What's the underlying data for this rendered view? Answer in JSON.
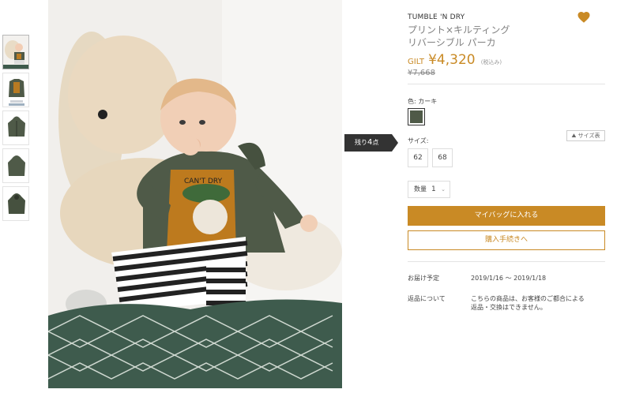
{
  "thumbnails": [
    {
      "label": "baby-with-bunny"
    },
    {
      "label": "jacket-front-with-tshirt"
    },
    {
      "label": "jacket-front"
    },
    {
      "label": "jacket-back"
    },
    {
      "label": "jacket-side"
    }
  ],
  "stock": {
    "prefix": "残り",
    "count": "4",
    "suffix": "点"
  },
  "product": {
    "brand": "TUMBLE 'N DRY",
    "name_line1": "プリント×キルティング",
    "name_line2": "リバーシブル パーカ",
    "gilt_label": "GILT",
    "price": "¥4,320",
    "tax_note": "(税込み)",
    "original_price": "¥7,668"
  },
  "color": {
    "label": "色: カーキ",
    "swatch_hex": "#4f5a48"
  },
  "size": {
    "label": "サイズ:",
    "chart_label": "サイズ表",
    "options": [
      "62",
      "68"
    ]
  },
  "quantity": {
    "label": "数量",
    "value": "1"
  },
  "buttons": {
    "add_to_bag": "マイバッグに入れる",
    "checkout": "購入手続きへ"
  },
  "delivery": {
    "label": "お届け予定",
    "value": "2019/1/16 〜 2019/1/18"
  },
  "returns": {
    "label": "返品について",
    "value": "こちらの商品は、お客様のご都合による返品・交換はできません。"
  },
  "colors": {
    "accent": "#c98a25",
    "dark": "#333333"
  }
}
